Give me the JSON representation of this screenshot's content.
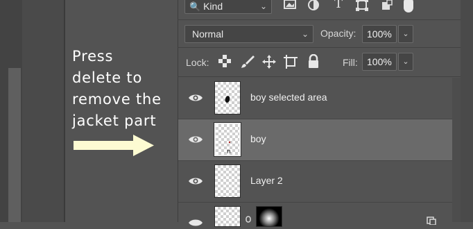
{
  "instruction": {
    "lines": [
      "Press",
      "delete to",
      "remove the",
      "jacket part"
    ]
  },
  "filter": {
    "kind_label": "Kind",
    "icons": [
      "image-filter-icon",
      "adjustment-filter-icon",
      "type-filter-icon",
      "shape-filter-icon",
      "smart-object-filter-icon",
      "filter-toggle-icon"
    ]
  },
  "blend": {
    "mode": "Normal",
    "opacity_label": "Opacity:",
    "opacity_value": "100%"
  },
  "lock": {
    "label": "Lock:",
    "icons": [
      "lock-transparent-pixels-icon",
      "lock-image-pixels-icon",
      "lock-position-icon",
      "prevent-auto-nesting-icon",
      "lock-all-icon"
    ],
    "fill_label": "Fill:",
    "fill_value": "100%"
  },
  "layers": [
    {
      "name": "boy selected area",
      "selected": false,
      "visible": true
    },
    {
      "name": "boy",
      "selected": true,
      "visible": true
    },
    {
      "name": "Layer 2",
      "selected": false,
      "visible": true
    }
  ],
  "colors": {
    "panel_bg": "#535353",
    "selected_row": "#6a6a6a",
    "arrow": "#fdfbd2",
    "text": "#f0f0f0"
  }
}
